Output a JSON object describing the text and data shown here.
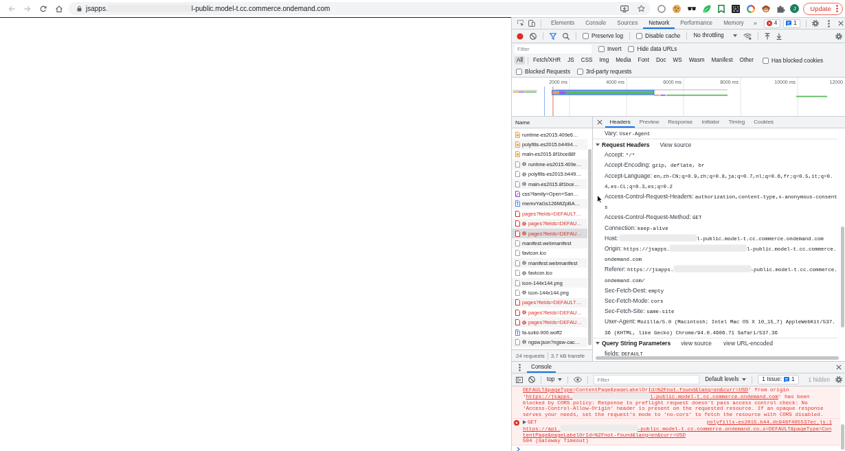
{
  "browser": {
    "back_disabled": true,
    "forward_disabled": true,
    "address": [
      {
        "kind": "text",
        "text": "jsapps."
      },
      {
        "kind": "redacted"
      },
      {
        "kind": "text",
        "text": "l-public.model-t.cc.commerce.ondemand.com"
      }
    ],
    "profile": "J",
    "update": "Update"
  },
  "devtools": {
    "tabs": [
      {
        "label": "Elements",
        "selected": false
      },
      {
        "label": "Console",
        "selected": false
      },
      {
        "label": "Sources",
        "selected": false
      },
      {
        "label": "Network",
        "selected": true
      },
      {
        "label": "Performance",
        "selected": false
      },
      {
        "label": "Memory",
        "selected": false
      }
    ],
    "more_tabs": "»",
    "errors": "4",
    "issues": "1"
  },
  "network": {
    "toolbar": {
      "recording": true,
      "filter_on": true,
      "checkboxes": [
        {
          "label": "Preserve log",
          "checked": false
        },
        {
          "label": "Disable cache",
          "checked": false
        }
      ],
      "throttling": "No throttling"
    },
    "filter": {
      "placeholder": "Filter",
      "checkboxes": [
        {
          "label": "Invert",
          "checked": false
        },
        {
          "label": "Hide data URLs",
          "checked": false
        }
      ]
    },
    "types": [
      {
        "label": "All",
        "selected": true
      },
      {
        "label": "Fetch/XHR",
        "selected": false
      },
      {
        "label": "JS",
        "selected": false
      },
      {
        "label": "CSS",
        "selected": false
      },
      {
        "label": "Img",
        "selected": false
      },
      {
        "label": "Media",
        "selected": false
      },
      {
        "label": "Font",
        "selected": false
      },
      {
        "label": "Doc",
        "selected": false
      },
      {
        "label": "WS",
        "selected": false
      },
      {
        "label": "Wasm",
        "selected": false
      },
      {
        "label": "Manifest",
        "selected": false
      },
      {
        "label": "Other",
        "selected": false
      }
    ],
    "type_checkbox": {
      "label": "Has blocked cookies",
      "checked": false
    },
    "more_checkboxes": [
      {
        "label": "Blocked Requests",
        "checked": false
      },
      {
        "label": "3rd-party requests",
        "checked": false
      }
    ],
    "overview": {
      "ticks": [
        "2000 ms",
        "4000 ms",
        "6000 ms",
        "8000 ms",
        "10000 ms",
        "12000"
      ]
    },
    "requests": {
      "column": "Name",
      "rows": [
        {
          "name": "runtime-es2015.409e6…",
          "kind": "script",
          "failed": false,
          "service_worker": false,
          "selected": false
        },
        {
          "name": "polyfills-es2015.b4494…",
          "kind": "script",
          "failed": false,
          "service_worker": false,
          "selected": false
        },
        {
          "name": "main-es2015.8f1bce88f",
          "kind": "script",
          "failed": false,
          "service_worker": false,
          "selected": false
        },
        {
          "name": "runtime-es2015.409e…",
          "kind": "document",
          "failed": false,
          "service_worker": true,
          "selected": false
        },
        {
          "name": "polyfills-es2015.b449…",
          "kind": "document",
          "failed": false,
          "service_worker": true,
          "selected": false
        },
        {
          "name": "main-es2015.8f1bce…",
          "kind": "document",
          "failed": false,
          "service_worker": true,
          "selected": false
        },
        {
          "name": "css?family=Open+San…",
          "kind": "stylesheet",
          "failed": false,
          "service_worker": false,
          "selected": false
        },
        {
          "name": "memvYaGs126MiZpBA…",
          "kind": "font",
          "failed": false,
          "service_worker": false,
          "selected": false
        },
        {
          "name": "pages?fields=DEFAULT…",
          "kind": "document",
          "failed": true,
          "service_worker": false,
          "selected": false
        },
        {
          "name": "pages?fields=DEFAU…",
          "kind": "document",
          "failed": true,
          "service_worker": true,
          "selected": false
        },
        {
          "name": "pages?fields=DEFAU…",
          "kind": "document",
          "failed": true,
          "service_worker": true,
          "selected": true
        },
        {
          "name": "manifest.webmanifest",
          "kind": "document",
          "failed": false,
          "service_worker": false,
          "selected": false
        },
        {
          "name": "favicon.ico",
          "kind": "document",
          "failed": false,
          "service_worker": false,
          "selected": false
        },
        {
          "name": "manifest.webmanifest",
          "kind": "document",
          "failed": false,
          "service_worker": true,
          "selected": false
        },
        {
          "name": "favicon.ico",
          "kind": "document",
          "failed": false,
          "service_worker": true,
          "selected": false
        },
        {
          "name": "icon-144x144.png",
          "kind": "document",
          "failed": false,
          "service_worker": false,
          "selected": false
        },
        {
          "name": "icon-144x144.png",
          "kind": "document",
          "failed": false,
          "service_worker": true,
          "selected": false
        },
        {
          "name": "pages?fields=DEFAULT…",
          "kind": "document",
          "failed": true,
          "service_worker": false,
          "selected": false
        },
        {
          "name": "pages?fields=DEFAU…",
          "kind": "document",
          "failed": true,
          "service_worker": true,
          "selected": false
        },
        {
          "name": "pages?fields=DEFAU…",
          "kind": "document",
          "failed": true,
          "service_worker": true,
          "selected": false
        },
        {
          "name": "fa-solid-900.woff2",
          "kind": "font",
          "failed": false,
          "service_worker": false,
          "selected": false
        },
        {
          "name": "ngsw.json?ngsw-cac…",
          "kind": "document",
          "failed": false,
          "service_worker": true,
          "selected": false
        }
      ],
      "summary": [
        "24 requests",
        "3.7 kB transfe"
      ]
    },
    "details": {
      "tabs": [
        {
          "label": "Headers",
          "selected": true
        },
        {
          "label": "Preview",
          "selected": false
        },
        {
          "label": "Response",
          "selected": false
        },
        {
          "label": "Initiator",
          "selected": false
        },
        {
          "label": "Timing",
          "selected": false
        },
        {
          "label": "Cookies",
          "selected": false
        }
      ],
      "sections": [
        {
          "headers": [
            {
              "name": "Vary:",
              "value": [
                {
                  "kind": "text",
                  "text": "User-Agent"
                }
              ]
            }
          ]
        },
        {
          "title": "Request Headers",
          "expanded": true,
          "links": [
            "View source"
          ],
          "headers": [
            {
              "name": "Accept:",
              "value": [
                {
                  "kind": "text",
                  "text": "*/*"
                }
              ]
            },
            {
              "name": "Accept-Encoding:",
              "value": [
                {
                  "kind": "text",
                  "text": "gzip, deflate, br"
                }
              ]
            },
            {
              "name": "Accept-Language:",
              "value": [
                {
                  "kind": "text",
                  "text": "en,zh-CN;q=0.9,zh;q=0.8,ja;q=0.7,nl;q=0.6,fr;q=0.5,it;q=0.4,es-CL;q=0.3,es;q=0.2"
                }
              ]
            },
            {
              "name": "Access-Control-Request-Headers:",
              "value": [
                {
                  "kind": "text",
                  "text": "authorization,content-type,x-anonymous-consents"
                }
              ]
            },
            {
              "name": "Access-Control-Request-Method:",
              "value": [
                {
                  "kind": "text",
                  "text": "GET"
                }
              ]
            },
            {
              "name": "Connection:",
              "value": [
                {
                  "kind": "text",
                  "text": "keep-alive"
                }
              ]
            },
            {
              "name": "Host:",
              "value": [
                {
                  "kind": "redacted"
                },
                {
                  "kind": "text",
                  "text": "l-public.model-t.cc.commerce.ondemand.com"
                }
              ]
            },
            {
              "name": "Origin:",
              "value": [
                {
                  "kind": "text",
                  "text": "https://jsapps."
                },
                {
                  "kind": "redacted"
                },
                {
                  "kind": "text",
                  "text": "l-public.model-t.cc.commerce.ondemand.com"
                }
              ]
            },
            {
              "name": "Referer:",
              "value": [
                {
                  "kind": "text",
                  "text": "https://jsapps."
                },
                {
                  "kind": "redacted"
                },
                {
                  "kind": "text",
                  "text": "-public.model-t.cc.commerce.ondemand.com/"
                }
              ]
            },
            {
              "name": "Sec-Fetch-Dest:",
              "value": [
                {
                  "kind": "text",
                  "text": "empty"
                }
              ]
            },
            {
              "name": "Sec-Fetch-Mode:",
              "value": [
                {
                  "kind": "text",
                  "text": "cors"
                }
              ]
            },
            {
              "name": "Sec-Fetch-Site:",
              "value": [
                {
                  "kind": "text",
                  "text": "same-site"
                }
              ]
            },
            {
              "name": "User-Agent:",
              "value": [
                {
                  "kind": "text",
                  "text": "Mozilla/5.0 (Macintosh; Intel Mac OS X 10_15_7) AppleWebKit/537.36 (KHTML, like Gecko) Chrome/94.0.4606.71 Safari/537.36"
                }
              ]
            }
          ]
        },
        {
          "title": "Query String Parameters",
          "expanded": true,
          "links": [
            "view source",
            "view URL-encoded"
          ],
          "headers": [
            {
              "name": "fields:",
              "value": [
                {
                  "kind": "text",
                  "text": "DEFAULT"
                }
              ]
            }
          ]
        }
      ]
    }
  },
  "console": {
    "tabs": [
      {
        "label": "Console",
        "selected": true
      }
    ],
    "context": "top",
    "filter_placeholder": "Filter",
    "levels": "Default levels",
    "issues": {
      "label": "1 Issue:",
      "count": "1"
    },
    "hidden": "1 hidden",
    "messages": [
      {
        "kind": "error",
        "continued": true,
        "expandable": false,
        "parts": [
          {
            "kind": "link",
            "parts": [
              {
                "kind": "text",
                "text": "DEFAULT&pageType=ContentPage&pageLabelOrId=%2Fnot-found&lang=en&curr=USD"
              }
            ]
          },
          {
            "kind": "text",
            "text": "' from origin '"
          },
          {
            "kind": "link",
            "parts": [
              {
                "kind": "text",
                "text": "https://jsapps."
              },
              {
                "kind": "redacted"
              },
              {
                "kind": "text",
                "text": "l-public.model-t.cc.commerce.ondemand.com"
              }
            ]
          },
          {
            "kind": "text",
            "text": "' has been blocked by CORS policy: Response to preflight request doesn't pass access control check: No 'Access-Control-Allow-Origin' header is present on the requested resource. If an opaque response serves your needs, set the request's mode to 'no-cors' to fetch the resource with CORS disabled."
          }
        ]
      },
      {
        "kind": "error",
        "continued": false,
        "expandable": true,
        "method": "GET",
        "source": "polyfills-es2015.b44…dc948f405537ec.js:1",
        "url": [
          {
            "kind": "text",
            "text": "https://api."
          },
          {
            "kind": "redacted"
          },
          {
            "kind": "text",
            "text": "-public.model-t.cc.commerce.ondemand.co…s=DEFAULT&pageType=ContentPage&pageLabelOrId=%2Fnot-found&lang=en&curr=USD"
          }
        ],
        "status": "504 (Gateway Timeout)"
      }
    ]
  }
}
